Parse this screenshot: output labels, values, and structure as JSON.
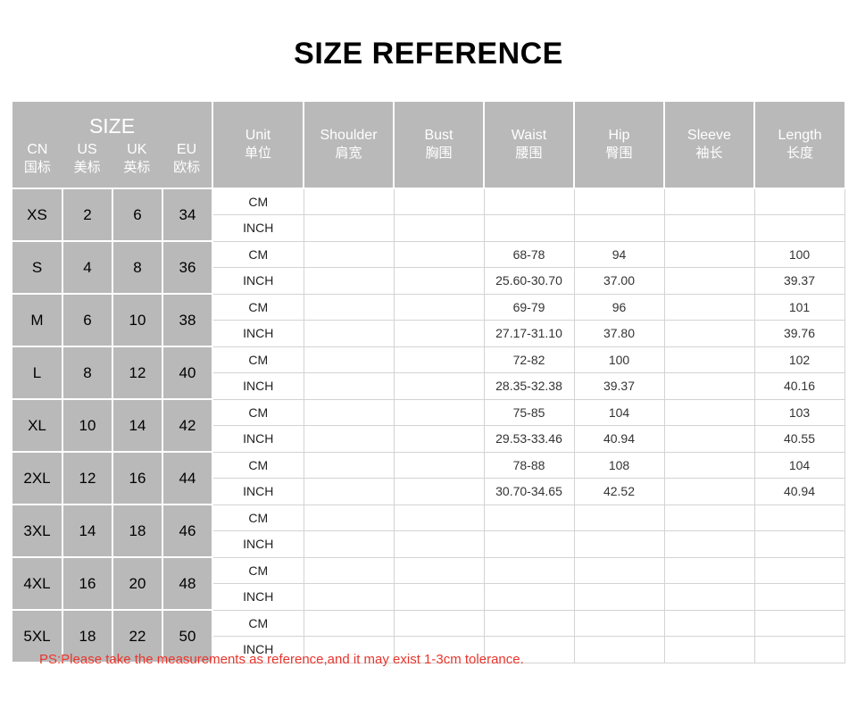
{
  "title": "SIZE REFERENCE",
  "note": "PS:Please take the measurements as reference,and it may exist 1-3cm tolerance.",
  "colors": {
    "header_bg": "#b9b9b9",
    "header_text": "#ffffff",
    "size_cell_bg": "#b9b9b9",
    "grid_line": "#d3d3d3",
    "note_text": "#e8352c",
    "title_text": "#000000",
    "data_text": "#333333"
  },
  "table": {
    "size_group_label": "SIZE",
    "size_standards": [
      {
        "code": "CN",
        "cn": "国标"
      },
      {
        "code": "US",
        "cn": "美标"
      },
      {
        "code": "UK",
        "cn": "英标"
      },
      {
        "code": "EU",
        "cn": "欧标"
      }
    ],
    "columns": [
      {
        "en": "Unit",
        "cn": "单位"
      },
      {
        "en": "Shoulder",
        "cn": "肩宽"
      },
      {
        "en": "Bust",
        "cn": "胸围"
      },
      {
        "en": "Waist",
        "cn": "腰围"
      },
      {
        "en": "Hip",
        "cn": "臀围"
      },
      {
        "en": "Sleeve",
        "cn": "袖长"
      },
      {
        "en": "Length",
        "cn": "长度"
      }
    ],
    "unit_labels": {
      "cm": "CM",
      "inch": "INCH"
    },
    "rows": [
      {
        "cn": "XS",
        "us": "2",
        "uk": "6",
        "eu": "34",
        "cm": {
          "shoulder": "",
          "bust": "",
          "waist": "",
          "hip": "",
          "sleeve": "",
          "length": ""
        },
        "inch": {
          "shoulder": "",
          "bust": "",
          "waist": "",
          "hip": "",
          "sleeve": "",
          "length": ""
        }
      },
      {
        "cn": "S",
        "us": "4",
        "uk": "8",
        "eu": "36",
        "cm": {
          "shoulder": "",
          "bust": "",
          "waist": "68-78",
          "hip": "94",
          "sleeve": "",
          "length": "100"
        },
        "inch": {
          "shoulder": "",
          "bust": "",
          "waist": "25.60-30.70",
          "hip": "37.00",
          "sleeve": "",
          "length": "39.37"
        }
      },
      {
        "cn": "M",
        "us": "6",
        "uk": "10",
        "eu": "38",
        "cm": {
          "shoulder": "",
          "bust": "",
          "waist": "69-79",
          "hip": "96",
          "sleeve": "",
          "length": "101"
        },
        "inch": {
          "shoulder": "",
          "bust": "",
          "waist": "27.17-31.10",
          "hip": "37.80",
          "sleeve": "",
          "length": "39.76"
        }
      },
      {
        "cn": "L",
        "us": "8",
        "uk": "12",
        "eu": "40",
        "cm": {
          "shoulder": "",
          "bust": "",
          "waist": "72-82",
          "hip": "100",
          "sleeve": "",
          "length": "102"
        },
        "inch": {
          "shoulder": "",
          "bust": "",
          "waist": "28.35-32.38",
          "hip": "39.37",
          "sleeve": "",
          "length": "40.16"
        }
      },
      {
        "cn": "XL",
        "us": "10",
        "uk": "14",
        "eu": "42",
        "cm": {
          "shoulder": "",
          "bust": "",
          "waist": "75-85",
          "hip": "104",
          "sleeve": "",
          "length": "103"
        },
        "inch": {
          "shoulder": "",
          "bust": "",
          "waist": "29.53-33.46",
          "hip": "40.94",
          "sleeve": "",
          "length": "40.55"
        }
      },
      {
        "cn": "2XL",
        "us": "12",
        "uk": "16",
        "eu": "44",
        "cm": {
          "shoulder": "",
          "bust": "",
          "waist": "78-88",
          "hip": "108",
          "sleeve": "",
          "length": "104"
        },
        "inch": {
          "shoulder": "",
          "bust": "",
          "waist": "30.70-34.65",
          "hip": "42.52",
          "sleeve": "",
          "length": "40.94"
        }
      },
      {
        "cn": "3XL",
        "us": "14",
        "uk": "18",
        "eu": "46",
        "cm": {
          "shoulder": "",
          "bust": "",
          "waist": "",
          "hip": "",
          "sleeve": "",
          "length": ""
        },
        "inch": {
          "shoulder": "",
          "bust": "",
          "waist": "",
          "hip": "",
          "sleeve": "",
          "length": ""
        }
      },
      {
        "cn": "4XL",
        "us": "16",
        "uk": "20",
        "eu": "48",
        "cm": {
          "shoulder": "",
          "bust": "",
          "waist": "",
          "hip": "",
          "sleeve": "",
          "length": ""
        },
        "inch": {
          "shoulder": "",
          "bust": "",
          "waist": "",
          "hip": "",
          "sleeve": "",
          "length": ""
        }
      },
      {
        "cn": "5XL",
        "us": "18",
        "uk": "22",
        "eu": "50",
        "cm": {
          "shoulder": "",
          "bust": "",
          "waist": "",
          "hip": "",
          "sleeve": "",
          "length": ""
        },
        "inch": {
          "shoulder": "",
          "bust": "",
          "waist": "",
          "hip": "",
          "sleeve": "",
          "length": ""
        }
      }
    ]
  }
}
